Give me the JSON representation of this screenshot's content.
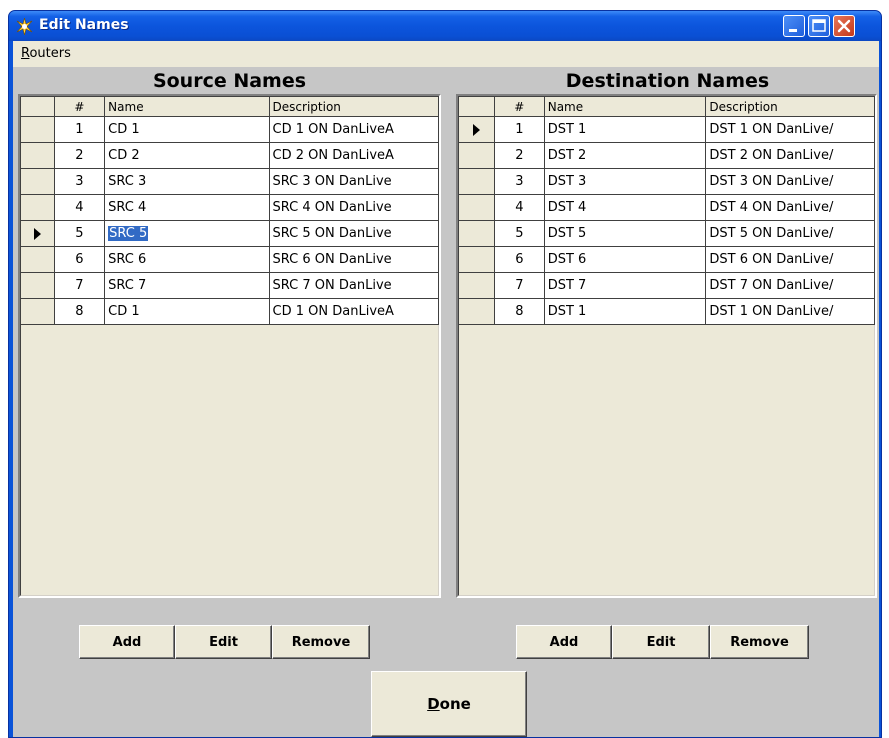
{
  "window": {
    "title": "Edit Names",
    "icon": "starburst-icon",
    "controls": [
      "minimize-icon",
      "maximize-icon",
      "close-icon"
    ]
  },
  "menu": {
    "routers": {
      "mnemonic": "R",
      "rest": "outers"
    }
  },
  "source": {
    "title": "Source Names",
    "headers": {
      "num": "#",
      "name": "Name",
      "description": "Description"
    },
    "selected_row": 5,
    "rows": [
      {
        "num": "1",
        "name": "CD 1",
        "description": "CD 1 ON DanLiveA"
      },
      {
        "num": "2",
        "name": "CD 2",
        "description": "CD 2 ON DanLiveA"
      },
      {
        "num": "3",
        "name": "SRC 3",
        "description": "SRC 3 ON DanLive"
      },
      {
        "num": "4",
        "name": "SRC 4",
        "description": "SRC 4 ON DanLive"
      },
      {
        "num": "5",
        "name": "SRC 5",
        "description": "SRC 5 ON DanLive"
      },
      {
        "num": "6",
        "name": "SRC 6",
        "description": "SRC 6 ON DanLive"
      },
      {
        "num": "7",
        "name": "SRC 7",
        "description": "SRC 7 ON DanLive"
      },
      {
        "num": "8",
        "name": "CD 1",
        "description": "CD 1 ON DanLiveA"
      }
    ],
    "buttons": {
      "add": "Add",
      "edit": "Edit",
      "remove": "Remove"
    }
  },
  "destination": {
    "title": "Destination Names",
    "headers": {
      "num": "#",
      "name": "Name",
      "description": "Description"
    },
    "selected_row": 1,
    "rows": [
      {
        "num": "1",
        "name": "DST 1",
        "description": "DST 1 ON DanLive/"
      },
      {
        "num": "2",
        "name": "DST 2",
        "description": "DST 2 ON DanLive/"
      },
      {
        "num": "3",
        "name": "DST 3",
        "description": "DST 3 ON DanLive/"
      },
      {
        "num": "4",
        "name": "DST 4",
        "description": "DST 4 ON DanLive/"
      },
      {
        "num": "5",
        "name": "DST 5",
        "description": "DST 5 ON DanLive/"
      },
      {
        "num": "6",
        "name": "DST 6",
        "description": "DST 6 ON DanLive/"
      },
      {
        "num": "7",
        "name": "DST 7",
        "description": "DST 7 ON DanLive/"
      },
      {
        "num": "8",
        "name": "DST 1",
        "description": "DST 1 ON DanLive/"
      }
    ],
    "buttons": {
      "add": "Add",
      "edit": "Edit",
      "remove": "Remove"
    }
  },
  "done": {
    "mnemonic": "D",
    "rest": "one"
  },
  "colors": {
    "titlebar": "#0c55dd",
    "face": "#ece9d8",
    "client": "#c6c6c6",
    "selection": "#316ac5"
  }
}
